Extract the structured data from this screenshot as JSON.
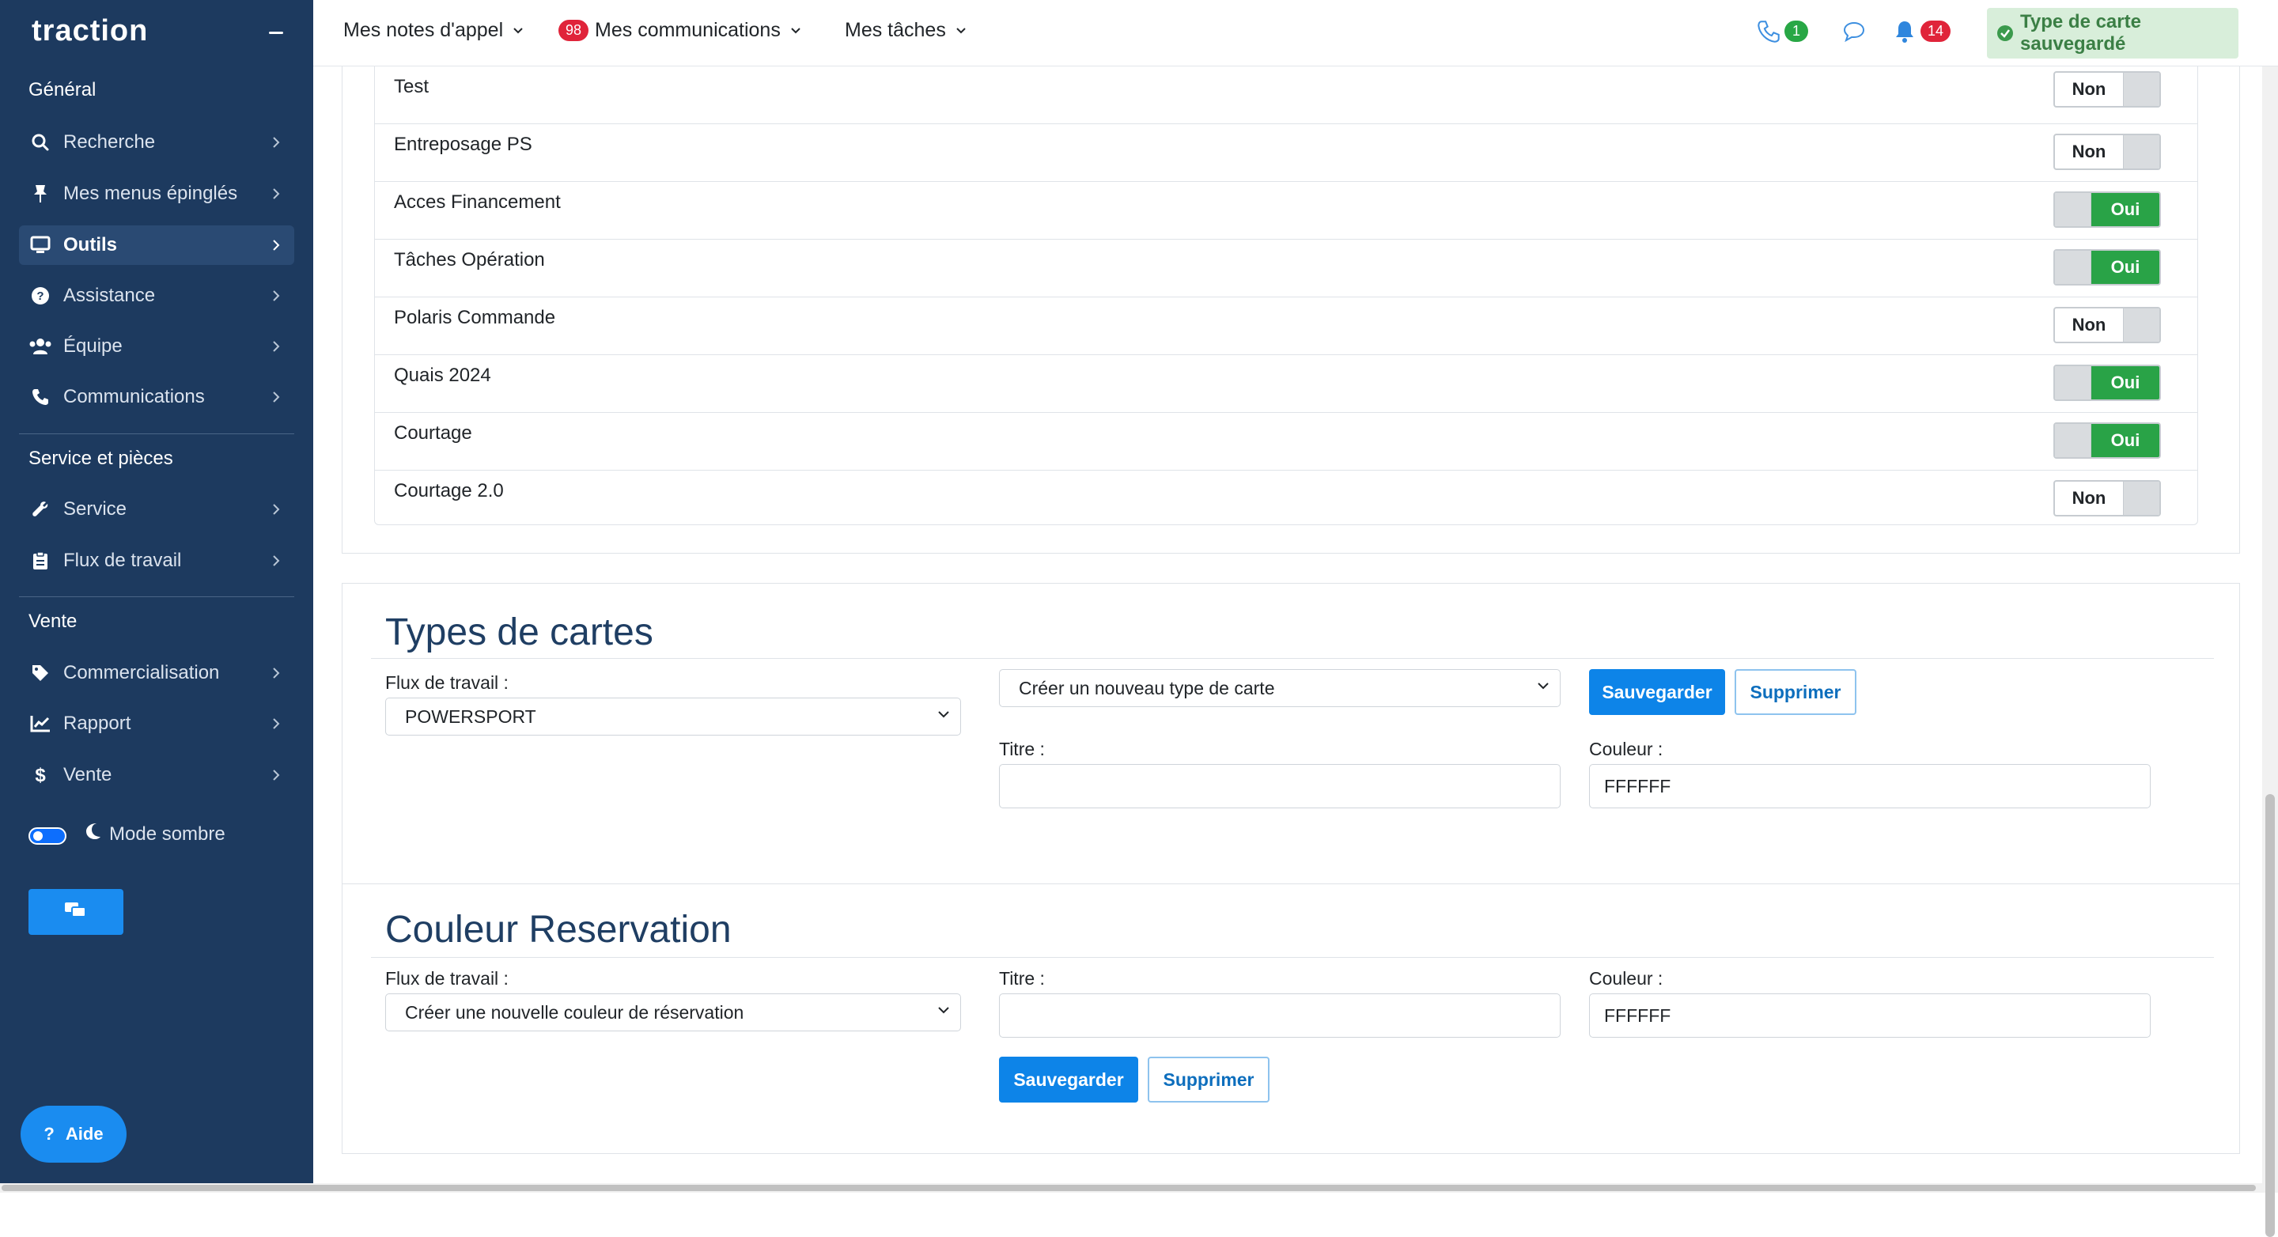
{
  "app": {
    "logo_text": "traction"
  },
  "sidebar": {
    "sections": [
      {
        "title": "Général"
      },
      {
        "title": "Service et pièces"
      },
      {
        "title": "Vente"
      }
    ],
    "items": [
      {
        "label": "Recherche",
        "icon": "search-icon",
        "active": false
      },
      {
        "label": "Mes menus épinglés",
        "icon": "pin-icon",
        "active": false
      },
      {
        "label": "Outils",
        "icon": "monitor-icon",
        "active": true
      },
      {
        "label": "Assistance",
        "icon": "question-circle-icon",
        "active": false
      },
      {
        "label": "Équipe",
        "icon": "users-icon",
        "active": false
      },
      {
        "label": "Communications",
        "icon": "phone-icon",
        "active": false
      },
      {
        "label": "Service",
        "icon": "wrench-icon",
        "active": false
      },
      {
        "label": "Flux de travail",
        "icon": "clipboard-icon",
        "active": false
      },
      {
        "label": "Commercialisation",
        "icon": "tag-icon",
        "active": false
      },
      {
        "label": "Rapport",
        "icon": "chart-line-icon",
        "active": false
      },
      {
        "label": "Vente",
        "icon": "dollar-icon",
        "active": false
      }
    ],
    "dark_mode_label": "Mode sombre",
    "help_label": "Aide"
  },
  "topbar": {
    "menus": [
      {
        "label": "Mes notes d'appel"
      },
      {
        "label": "Mes communications",
        "badge": "98"
      },
      {
        "label": "Mes tâches"
      }
    ],
    "phone_badge": "1",
    "bell_badge": "14",
    "toast": "Type de carte sauvegardé"
  },
  "toggle_list": [
    {
      "label": "Test",
      "state": "Non"
    },
    {
      "label": "Entreposage PS",
      "state": "Non"
    },
    {
      "label": "Acces Financement",
      "state": "Oui"
    },
    {
      "label": "Tâches Opération",
      "state": "Oui"
    },
    {
      "label": "Polaris Commande",
      "state": "Non"
    },
    {
      "label": "Quais 2024",
      "state": "Oui"
    },
    {
      "label": "Courtage",
      "state": "Oui"
    },
    {
      "label": "Courtage 2.0",
      "state": "Non"
    }
  ],
  "types_cartes": {
    "title": "Types de cartes",
    "workflow_label": "Flux de travail :",
    "workflow_value": "POWERSPORT",
    "type_select": "Créer un nouveau type de carte",
    "save_label": "Sauvegarder",
    "delete_label": "Supprimer",
    "titre_label": "Titre :",
    "titre_value": "",
    "couleur_label": "Couleur :",
    "couleur_value": "FFFFFF"
  },
  "couleur_reservation": {
    "title": "Couleur Reservation",
    "workflow_label": "Flux de travail :",
    "workflow_value": "Créer une nouvelle couleur de réservation",
    "titre_label": "Titre :",
    "titre_value": "",
    "couleur_label": "Couleur :",
    "couleur_value": "FFFFFF",
    "save_label": "Sauvegarder",
    "delete_label": "Supprimer"
  },
  "colors": {
    "sidebar_bg": "#1d3a5f",
    "accent": "#0d84e8",
    "toggle_on": "#29a347",
    "badge_red": "#e0243a",
    "badge_green": "#28a745",
    "heading": "#1f3e63"
  }
}
